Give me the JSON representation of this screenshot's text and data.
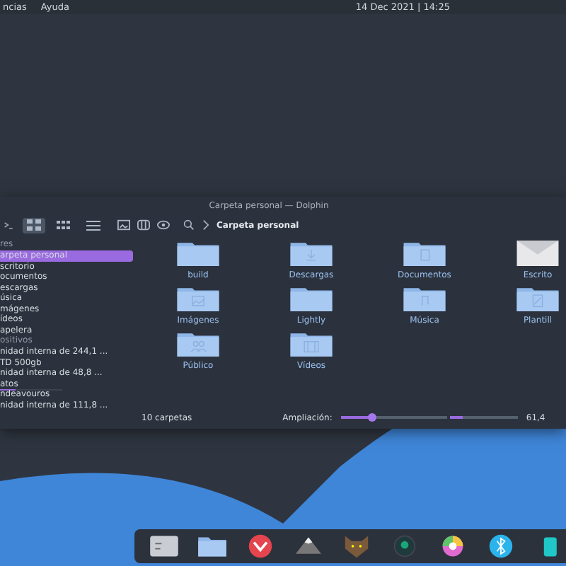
{
  "top_bar": {
    "menus": [
      "ncias",
      "Ayuda"
    ],
    "clock": "14 Dec 2021 | 14:25"
  },
  "window": {
    "title": "Carpeta personal — Dolphin",
    "toolbar": {
      "views": [
        {
          "kind": "icons",
          "selected": true
        },
        {
          "kind": "compact",
          "selected": false
        },
        {
          "kind": "details",
          "selected": false
        }
      ],
      "breadcrumb": "Carpeta personal"
    },
    "sidebar": {
      "sections": [
        {
          "heading": "res",
          "items": [
            {
              "label": "arpeta personal",
              "selected": true
            },
            {
              "label": "scritorio",
              "selected": false
            },
            {
              "label": "ocumentos",
              "selected": false
            },
            {
              "label": "escargas",
              "selected": false
            },
            {
              "label": "úsica",
              "selected": false
            },
            {
              "label": "mágenes",
              "selected": false
            },
            {
              "label": "ídeos",
              "selected": false
            },
            {
              "label": "apelera",
              "selected": false
            }
          ]
        },
        {
          "heading": "ositivos",
          "items": [
            {
              "label": "nidad interna de 244,1 ...",
              "selected": false
            },
            {
              "label": "TD 500gb",
              "selected": false
            },
            {
              "label": "nidad interna de 48,8 ...",
              "selected": false
            },
            {
              "label": "atos",
              "selected": false,
              "level": 0.25
            },
            {
              "label": "ndeavouros",
              "selected": false
            },
            {
              "label": "nidad interna de 111,8 ...",
              "selected": false
            }
          ]
        }
      ]
    },
    "folders": [
      {
        "name": "build",
        "kind": "plain"
      },
      {
        "name": "Descargas",
        "kind": "download"
      },
      {
        "name": "Documentos",
        "kind": "document"
      },
      {
        "name": "Escrito",
        "kind": "desktop"
      },
      {
        "name": "Imágenes",
        "kind": "image"
      },
      {
        "name": "Lightly",
        "kind": "plain"
      },
      {
        "name": "Música",
        "kind": "music"
      },
      {
        "name": "Plantill",
        "kind": "template"
      },
      {
        "name": "Público",
        "kind": "people"
      },
      {
        "name": "Vídeos",
        "kind": "video"
      }
    ],
    "status_bar": {
      "count": "10 carpetas",
      "zoom_label": "Ampliación:",
      "zoom": {
        "level": 0.3
      },
      "space": {
        "level": 0.2
      },
      "free": "61,4"
    }
  }
}
